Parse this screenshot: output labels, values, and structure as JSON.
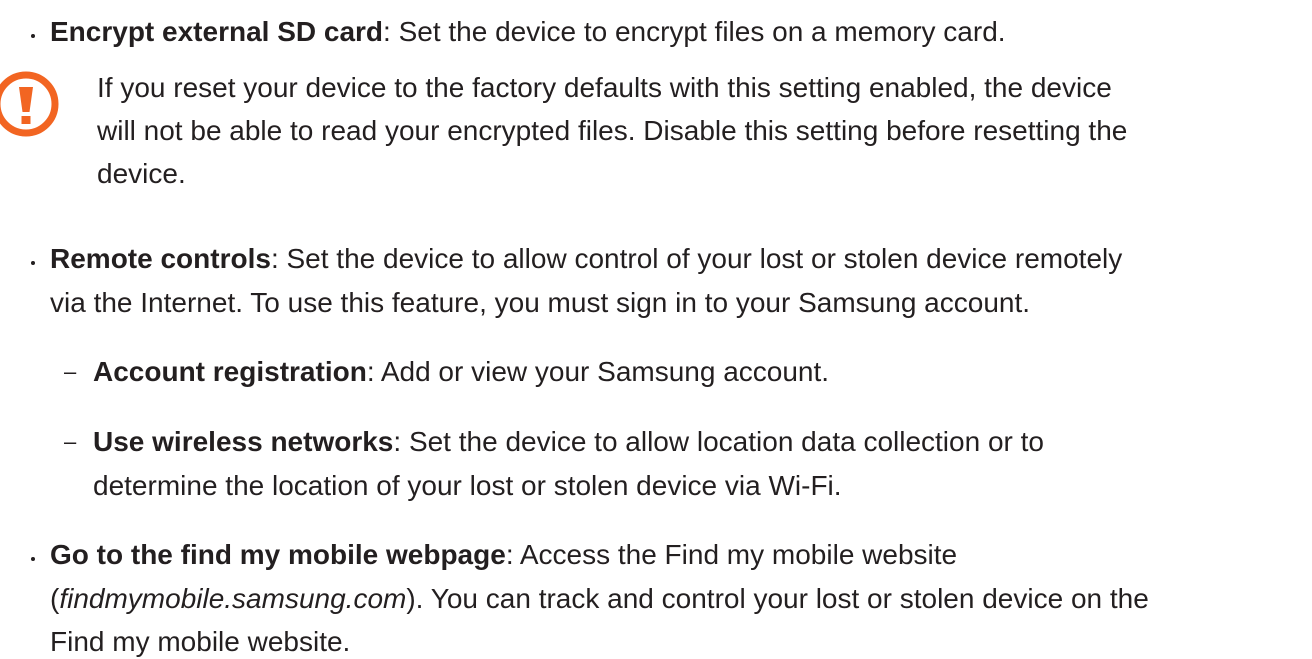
{
  "accent_color": "#f26522",
  "items": [
    {
      "term": "Encrypt external SD card",
      "sep": ": ",
      "text": "Set the device to encrypt files on a memory card."
    },
    {
      "note_icon": "caution-icon",
      "note_lines": [
        "If you reset your device to the factory defaults with this setting enabled, the device",
        "will not be able to read your encrypted files. Disable this setting before resetting the",
        "device."
      ]
    },
    {
      "term": "Remote controls",
      "sep": ": ",
      "line1": "Set the device to allow control of your lost or stolen device remotely",
      "line2": "via the Internet. To use this feature, you must sign in to your Samsung account."
    },
    {
      "dash": "–",
      "term": "Account registration",
      "sep": ": ",
      "text": "Add or view your Samsung account."
    },
    {
      "dash": "–",
      "term": "Use wireless networks",
      "sep": ": ",
      "line1": "Set the device to allow location data collection or to",
      "line2": "determine the location of your lost or stolen device via Wi-Fi."
    },
    {
      "term": "Go to the find my mobile webpage",
      "sep": ": ",
      "line1": "Access the Find my mobile website",
      "line2_pre": "(",
      "line2_link": "findmymobile.samsung.com",
      "line2_post": "). You can track and control your lost or stolen device on the",
      "line3": "Find my mobile website."
    }
  ]
}
